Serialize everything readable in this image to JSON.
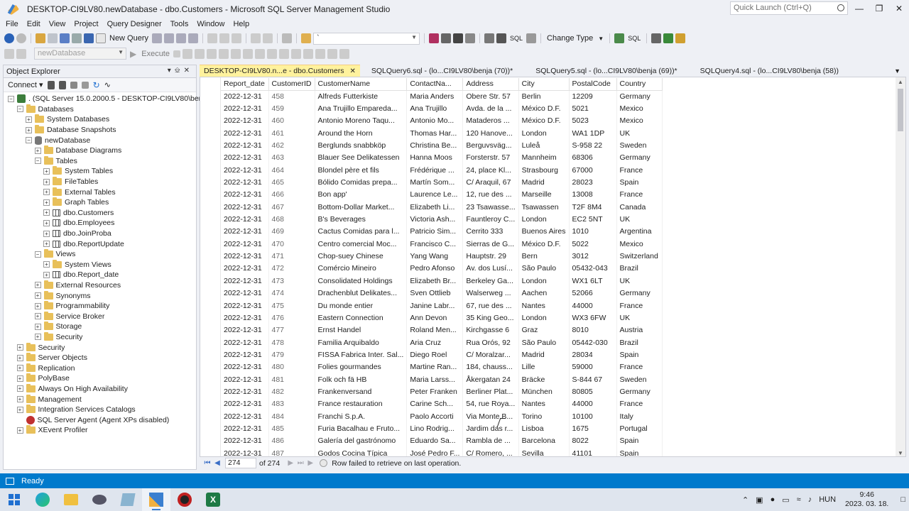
{
  "window": {
    "title": "DESKTOP-CI9LV80.newDatabase - dbo.Customers - Microsoft SQL Server Management Studio",
    "quick_launch": "Quick Launch (Ctrl+Q)"
  },
  "menu": [
    "File",
    "Edit",
    "View",
    "Project",
    "Query Designer",
    "Tools",
    "Window",
    "Help"
  ],
  "toolbar": {
    "new_query": "New Query",
    "change_type": "Change Type",
    "combo_value": "`",
    "database": "newDatabase",
    "execute": "Execute"
  },
  "object_explorer": {
    "title": "Object Explorer",
    "connect": "Connect",
    "tree": [
      {
        "level": 0,
        "exp": "−",
        "icon": "srv",
        "label": ". (SQL Server 15.0.2000.5 - DESKTOP-CI9LV80\\benja)"
      },
      {
        "level": 1,
        "exp": "−",
        "icon": "fld",
        "label": "Databases"
      },
      {
        "level": 2,
        "exp": "+",
        "icon": "fld",
        "label": "System Databases"
      },
      {
        "level": 2,
        "exp": "+",
        "icon": "fld",
        "label": "Database Snapshots"
      },
      {
        "level": 2,
        "exp": "−",
        "icon": "db",
        "label": "newDatabase"
      },
      {
        "level": 3,
        "exp": "+",
        "icon": "fld",
        "label": "Database Diagrams"
      },
      {
        "level": 3,
        "exp": "−",
        "icon": "fld",
        "label": "Tables"
      },
      {
        "level": 4,
        "exp": "+",
        "icon": "fld",
        "label": "System Tables"
      },
      {
        "level": 4,
        "exp": "+",
        "icon": "fld",
        "label": "FileTables"
      },
      {
        "level": 4,
        "exp": "+",
        "icon": "fld",
        "label": "External Tables"
      },
      {
        "level": 4,
        "exp": "+",
        "icon": "fld",
        "label": "Graph Tables"
      },
      {
        "level": 4,
        "exp": "+",
        "icon": "tbl",
        "label": "dbo.Customers"
      },
      {
        "level": 4,
        "exp": "+",
        "icon": "tbl",
        "label": "dbo.Employees"
      },
      {
        "level": 4,
        "exp": "+",
        "icon": "tbl",
        "label": "dbo.JoinProba"
      },
      {
        "level": 4,
        "exp": "+",
        "icon": "tbl",
        "label": "dbo.ReportUpdate"
      },
      {
        "level": 3,
        "exp": "−",
        "icon": "fld",
        "label": "Views"
      },
      {
        "level": 4,
        "exp": "+",
        "icon": "fld",
        "label": "System Views"
      },
      {
        "level": 4,
        "exp": "+",
        "icon": "tbl",
        "label": "dbo.Report_date"
      },
      {
        "level": 3,
        "exp": "+",
        "icon": "fld",
        "label": "External Resources"
      },
      {
        "level": 3,
        "exp": "+",
        "icon": "fld",
        "label": "Synonyms"
      },
      {
        "level": 3,
        "exp": "+",
        "icon": "fld",
        "label": "Programmability"
      },
      {
        "level": 3,
        "exp": "+",
        "icon": "fld",
        "label": "Service Broker"
      },
      {
        "level": 3,
        "exp": "+",
        "icon": "fld",
        "label": "Storage"
      },
      {
        "level": 3,
        "exp": "+",
        "icon": "fld",
        "label": "Security"
      },
      {
        "level": 1,
        "exp": "+",
        "icon": "fld",
        "label": "Security"
      },
      {
        "level": 1,
        "exp": "+",
        "icon": "fld",
        "label": "Server Objects"
      },
      {
        "level": 1,
        "exp": "+",
        "icon": "fld",
        "label": "Replication"
      },
      {
        "level": 1,
        "exp": "+",
        "icon": "fld",
        "label": "PolyBase"
      },
      {
        "level": 1,
        "exp": "+",
        "icon": "fld",
        "label": "Always On High Availability"
      },
      {
        "level": 1,
        "exp": "+",
        "icon": "fld",
        "label": "Management"
      },
      {
        "level": 1,
        "exp": "+",
        "icon": "fld",
        "label": "Integration Services Catalogs"
      },
      {
        "level": 1,
        "exp": "",
        "icon": "agent",
        "label": "SQL Server Agent (Agent XPs disabled)"
      },
      {
        "level": 1,
        "exp": "+",
        "icon": "fld",
        "label": "XEvent Profiler"
      }
    ]
  },
  "tabs": [
    {
      "label": "DESKTOP-CI9LV80.n...e - dbo.Customers",
      "active": true
    },
    {
      "label": "SQLQuery6.sql - (lo...CI9LV80\\benja (70))*",
      "active": false
    },
    {
      "label": "SQLQuery5.sql - (lo...CI9LV80\\benja (69))*",
      "active": false
    },
    {
      "label": "SQLQuery4.sql - (lo...CI9LV80\\benja (58))",
      "active": false
    }
  ],
  "grid": {
    "columns": [
      "Report_date",
      "CustomerID",
      "CustomerName",
      "ContactNa...",
      "Address",
      "City",
      "PostalCode",
      "Country"
    ],
    "rows": [
      [
        "2022-12-31",
        "458",
        "Alfreds Futterkiste",
        "Maria Anders",
        "Obere Str. 57",
        "Berlin",
        "12209",
        "Germany"
      ],
      [
        "2022-12-31",
        "459",
        "Ana Trujillo Empareda...",
        "Ana Trujillo",
        "Avda. de la ...",
        "México D.F.",
        "5021",
        "Mexico"
      ],
      [
        "2022-12-31",
        "460",
        "Antonio Moreno Taqu...",
        "Antonio Mo...",
        "Mataderos ...",
        "México D.F.",
        "5023",
        "Mexico"
      ],
      [
        "2022-12-31",
        "461",
        "Around the Horn",
        "Thomas Har...",
        "120 Hanove...",
        "London",
        "WA1 1DP",
        "UK"
      ],
      [
        "2022-12-31",
        "462",
        "Berglunds snabbköp",
        "Christina Be...",
        "Berguvsväg...",
        "Luleå",
        "S-958 22",
        "Sweden"
      ],
      [
        "2022-12-31",
        "463",
        "Blauer See Delikatessen",
        "Hanna Moos",
        "Forsterstr. 57",
        "Mannheim",
        "68306",
        "Germany"
      ],
      [
        "2022-12-31",
        "464",
        "Blondel père et fils",
        "Frédérique ...",
        "24, place Kl...",
        "Strasbourg",
        "67000",
        "France"
      ],
      [
        "2022-12-31",
        "465",
        "Bólido Comidas prepa...",
        "Martín Som...",
        "C/ Araquil, 67",
        "Madrid",
        "28023",
        "Spain"
      ],
      [
        "2022-12-31",
        "466",
        "Bon app'",
        "Laurence Le...",
        "12, rue des ...",
        "Marseille",
        "13008",
        "France"
      ],
      [
        "2022-12-31",
        "467",
        "Bottom-Dollar Market...",
        "Elizabeth Li...",
        "23 Tsawasse...",
        "Tsawassen",
        "T2F 8M4",
        "Canada"
      ],
      [
        "2022-12-31",
        "468",
        "B's Beverages",
        "Victoria Ash...",
        "Fauntleroy C...",
        "London",
        "EC2 5NT",
        "UK"
      ],
      [
        "2022-12-31",
        "469",
        "Cactus Comidas para l...",
        "Patricio Sim...",
        "Cerrito 333",
        "Buenos Aires",
        "1010",
        "Argentina"
      ],
      [
        "2022-12-31",
        "470",
        "Centro comercial Moc...",
        "Francisco C...",
        "Sierras de G...",
        "México D.F.",
        "5022",
        "Mexico"
      ],
      [
        "2022-12-31",
        "471",
        "Chop-suey Chinese",
        "Yang Wang",
        "Hauptstr. 29",
        "Bern",
        "3012",
        "Switzerland"
      ],
      [
        "2022-12-31",
        "472",
        "Comércio Mineiro",
        "Pedro Afonso",
        "Av. dos Lusí...",
        "São Paulo",
        "05432-043",
        "Brazil"
      ],
      [
        "2022-12-31",
        "473",
        "Consolidated Holdings",
        "Elizabeth Br...",
        "Berkeley Ga...",
        "London",
        "WX1 6LT",
        "UK"
      ],
      [
        "2022-12-31",
        "474",
        "Drachenblut Delikates...",
        "Sven Ottlieb",
        "Walserweg ...",
        "Aachen",
        "52066",
        "Germany"
      ],
      [
        "2022-12-31",
        "475",
        "Du monde entier",
        "Janine Labr...",
        "67, rue des ...",
        "Nantes",
        "44000",
        "France"
      ],
      [
        "2022-12-31",
        "476",
        "Eastern Connection",
        "Ann Devon",
        "35 King Geo...",
        "London",
        "WX3 6FW",
        "UK"
      ],
      [
        "2022-12-31",
        "477",
        "Ernst Handel",
        "Roland Men...",
        "Kirchgasse 6",
        "Graz",
        "8010",
        "Austria"
      ],
      [
        "2022-12-31",
        "478",
        "Familia Arquibaldo",
        "Aria Cruz",
        "Rua Orós, 92",
        "São Paulo",
        "05442-030",
        "Brazil"
      ],
      [
        "2022-12-31",
        "479",
        "FISSA Fabrica Inter. Sal...",
        "Diego Roel",
        "C/ Moralzar...",
        "Madrid",
        "28034",
        "Spain"
      ],
      [
        "2022-12-31",
        "480",
        "Folies gourmandes",
        "Martine Ran...",
        "184, chauss...",
        "Lille",
        "59000",
        "France"
      ],
      [
        "2022-12-31",
        "481",
        "Folk och fä HB",
        "Maria Larss...",
        "Åkergatan 24",
        "Bräcke",
        "S-844 67",
        "Sweden"
      ],
      [
        "2022-12-31",
        "482",
        "Frankenversand",
        "Peter Franken",
        "Berliner Plat...",
        "München",
        "80805",
        "Germany"
      ],
      [
        "2022-12-31",
        "483",
        "France restauration",
        "Carine Sch...",
        "54, rue Roya...",
        "Nantes",
        "44000",
        "France"
      ],
      [
        "2022-12-31",
        "484",
        "Franchi S.p.A.",
        "Paolo Accorti",
        "Via Monte B...",
        "Torino",
        "10100",
        "Italy"
      ],
      [
        "2022-12-31",
        "485",
        "Furia Bacalhau e Fruto...",
        "Lino Rodrig...",
        "Jardim das r...",
        "Lisboa",
        "1675",
        "Portugal"
      ],
      [
        "2022-12-31",
        "486",
        "Galería del gastrónomo",
        "Eduardo Sa...",
        "Rambla de ...",
        "Barcelona",
        "8022",
        "Spain"
      ],
      [
        "2022-12-31",
        "487",
        "Godos Cocina Típica",
        "José Pedro F...",
        "C/ Romero, ...",
        "Sevilla",
        "41101",
        "Spain"
      ]
    ]
  },
  "navigation": {
    "current": "274",
    "of_total": "of 274",
    "message": "Row failed to retrieve on last operation."
  },
  "status": {
    "text": "Ready"
  },
  "taskbar": {
    "language": "HUN",
    "time": "9:46",
    "date": "2023. 03. 18."
  }
}
